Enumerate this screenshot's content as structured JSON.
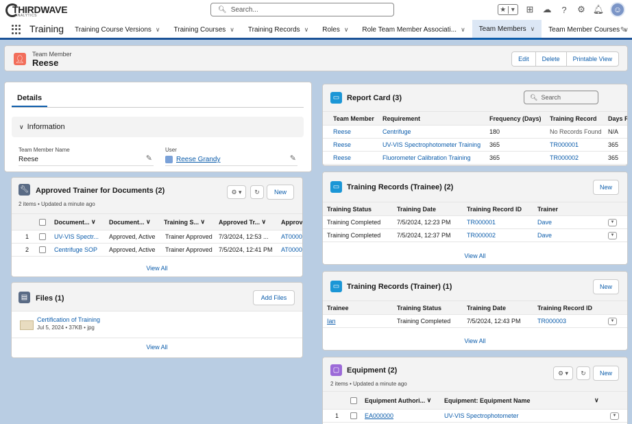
{
  "brand": {
    "logo_main": "THIRDWAVE",
    "logo_sub": "ANALYTICS"
  },
  "header": {
    "search_placeholder": "Search..."
  },
  "nav": {
    "app_name": "Training",
    "items": [
      {
        "label": "Training Course Versions"
      },
      {
        "label": "Training Courses"
      },
      {
        "label": "Training Records"
      },
      {
        "label": "Roles"
      },
      {
        "label": "Role Team Member Associati..."
      },
      {
        "label": "Team Members",
        "active": true
      },
      {
        "label": "Team Member Courses"
      }
    ]
  },
  "record": {
    "object": "Team Member",
    "name": "Reese",
    "actions": [
      "Edit",
      "Delete",
      "Printable View"
    ]
  },
  "details": {
    "tab": "Details",
    "section": "Information",
    "fields": [
      {
        "label": "Team Member Name",
        "value": "Reese"
      },
      {
        "label": "User",
        "value": "Reese Grandy"
      }
    ]
  },
  "approved_trainer": {
    "title": "Approved Trainer for Documents (2)",
    "meta": "2 items • Updated a minute ago",
    "new_label": "New",
    "columns": [
      "Document...",
      "Document...",
      "Training S...",
      "Approved Tr...",
      "Approv"
    ],
    "rows": [
      {
        "num": "1",
        "doc": "UV-VIS Spectr...",
        "status": "Approved, Active",
        "training": "Trainer Approved",
        "approved": "7/3/2024, 12:53 ...",
        "id": "AT0000"
      },
      {
        "num": "2",
        "doc": "Centrifuge SOP",
        "status": "Approved, Active",
        "training": "Trainer Approved",
        "approved": "7/5/2024, 12:41 PM",
        "id": "AT0000"
      }
    ],
    "view_all": "View All"
  },
  "files": {
    "title": "Files (1)",
    "add_label": "Add Files",
    "items": [
      {
        "name": "Certification of Training",
        "meta": "Jul 5, 2024 • 37KB • jpg"
      }
    ],
    "view_all": "View All"
  },
  "report_card": {
    "title": "Report Card (3)",
    "search_placeholder": "Search",
    "columns": [
      "Team Member",
      "Requirement",
      "Frequency (Days)",
      "Training Record",
      "Days R"
    ],
    "rows": [
      {
        "member": "Reese",
        "req": "Centrifuge",
        "freq": "180",
        "record": "No Records Found",
        "days": "N/A"
      },
      {
        "member": "Reese",
        "req": "UV-VIS Spectrophotometer Training",
        "freq": "365",
        "record": "TR000001",
        "days": "365"
      },
      {
        "member": "Reese",
        "req": "Fluorometer Calibration Training",
        "freq": "365",
        "record": "TR000002",
        "days": "365"
      }
    ]
  },
  "trainee": {
    "title": "Training Records (Trainee) (2)",
    "new_label": "New",
    "columns": [
      "Training Status",
      "Training Date",
      "Training Record ID",
      "Trainer"
    ],
    "rows": [
      {
        "status": "Training Completed",
        "date": "7/5/2024, 12:23 PM",
        "id": "TR000001",
        "trainer": "Dave"
      },
      {
        "status": "Training Completed",
        "date": "7/5/2024, 12:37 PM",
        "id": "TR000002",
        "trainer": "Dave"
      }
    ],
    "view_all": "View All"
  },
  "trainer": {
    "title": "Training Records (Trainer) (1)",
    "new_label": "New",
    "columns": [
      "Trainee",
      "Training Status",
      "Training Date",
      "Training Record ID"
    ],
    "rows": [
      {
        "trainee": "Ian",
        "status": "Training Completed",
        "date": "7/5/2024, 12:43 PM",
        "id": "TR000003"
      }
    ],
    "view_all": "View All"
  },
  "equipment": {
    "title": "Equipment (2)",
    "meta": "2 items • Updated a minute ago",
    "new_label": "New",
    "columns": [
      "Equipment Authori...",
      "Equipment: Equipment Name"
    ],
    "rows": [
      {
        "num": "1",
        "id": "EA000000",
        "name": "UV-VIS Spectrophotometer"
      }
    ]
  },
  "colors": {
    "accent": "#0b5cab",
    "record_icon": "#f26e5b",
    "card_icon_blue": "#1b96d6",
    "trainer_icon": "#5a6b85",
    "equipment_icon": "#9c6ad8"
  }
}
